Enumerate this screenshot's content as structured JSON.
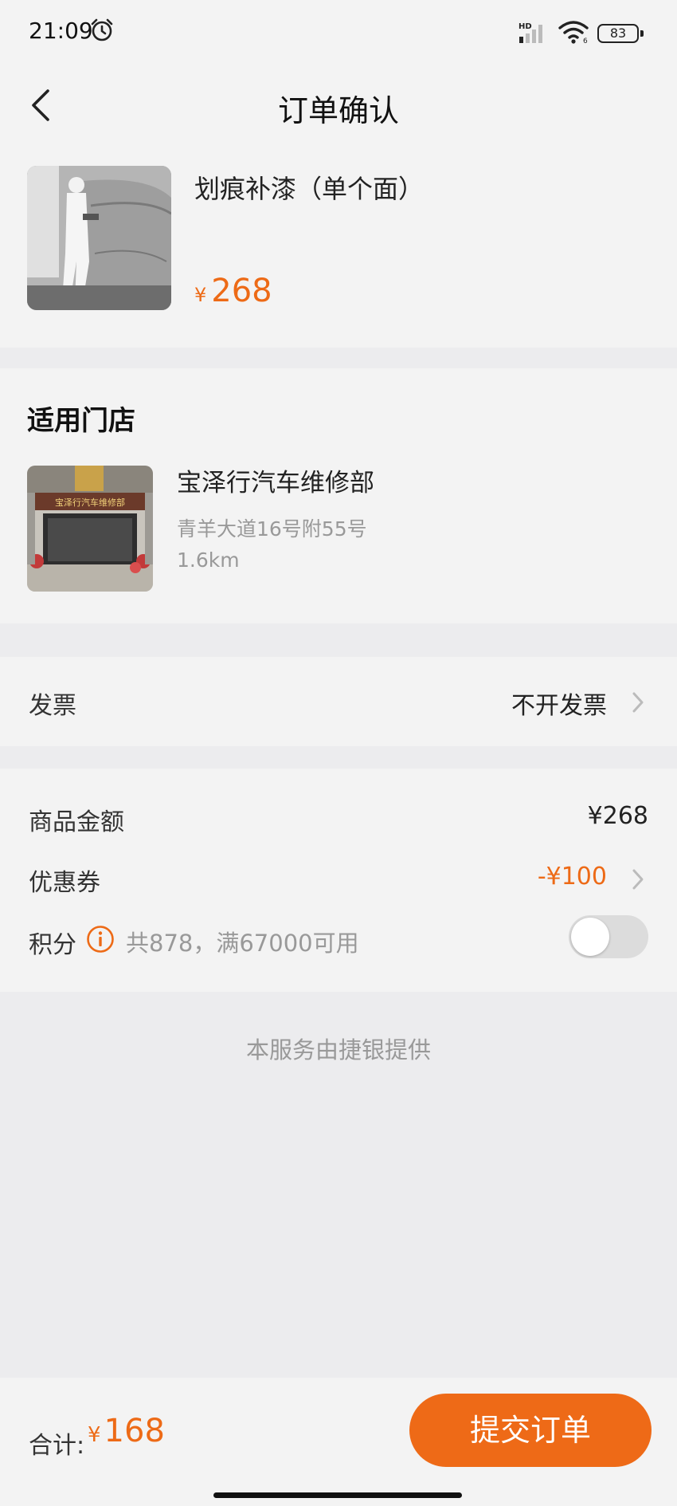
{
  "status_bar": {
    "time": "21:09",
    "network_label": "HD",
    "wifi_label": "6",
    "battery": "83"
  },
  "header": {
    "title": "订单确认"
  },
  "product": {
    "name": "划痕补漆（单个面）",
    "currency": "¥",
    "price": "268"
  },
  "store": {
    "section_title": "适用门店",
    "name": "宝泽行汽车维修部",
    "address": "青羊大道16号附55号",
    "distance": "1.6km",
    "sign_text": "宝泽行汽车维修部"
  },
  "invoice": {
    "label": "发票",
    "value": "不开发票"
  },
  "pricing": {
    "amount_label": "商品金额",
    "amount_value": "¥268",
    "coupon_label": "优惠券",
    "coupon_value": "-¥100",
    "points_label": "积分",
    "points_desc": "共878，满67000可用",
    "points_enabled": false
  },
  "provider_note": "本服务由捷银提供",
  "footer": {
    "total_label": "合计:",
    "currency": "¥",
    "total_value": "168",
    "submit_label": "提交订单"
  },
  "colors": {
    "accent": "#ee6a17",
    "price_text": "#ed6a16",
    "page_bg": "#ececee",
    "card_bg": "#f3f3f3"
  }
}
